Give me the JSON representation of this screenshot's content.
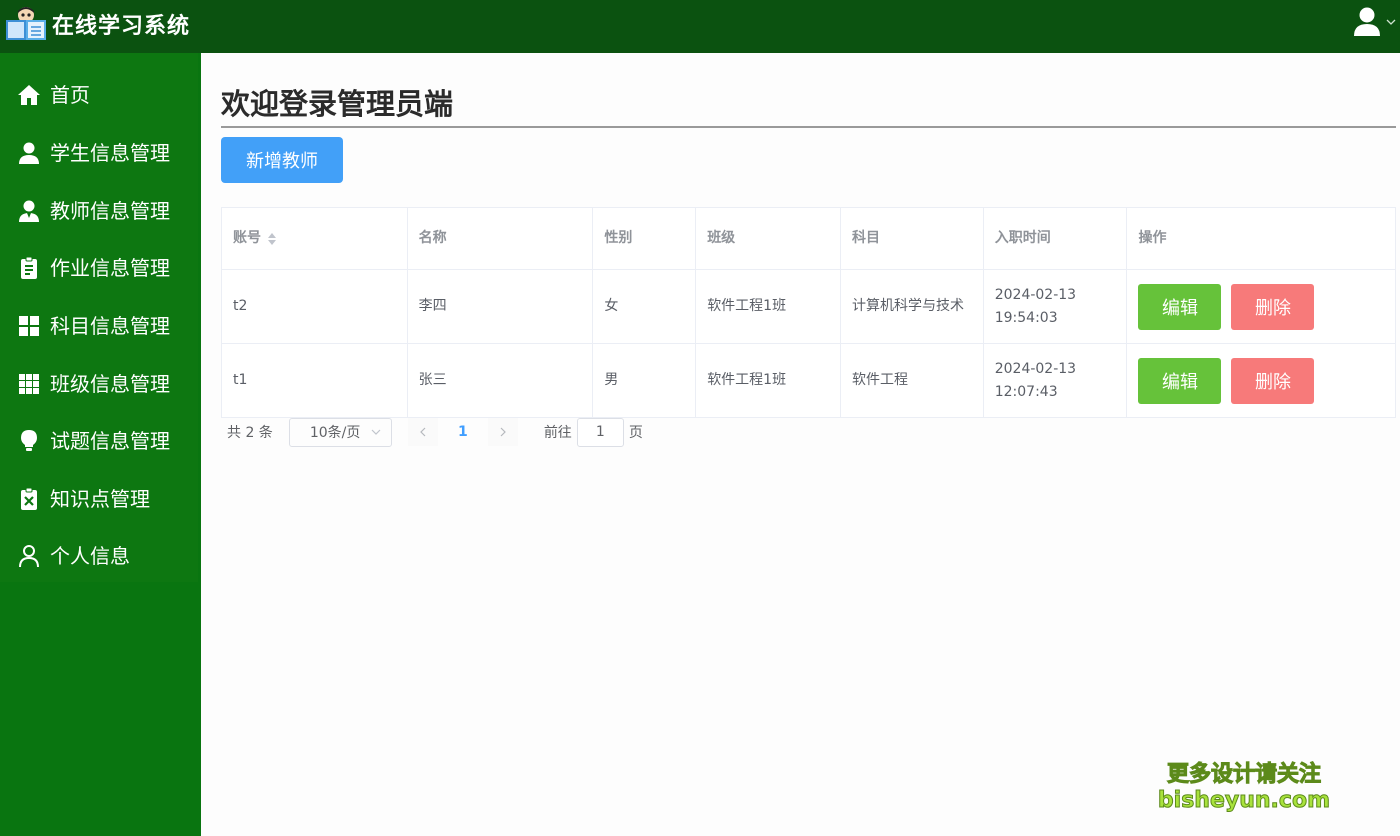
{
  "app": {
    "title": "在线学习系统"
  },
  "sidebar": {
    "items": [
      {
        "label": "首页",
        "icon": "home-icon"
      },
      {
        "label": "学生信息管理",
        "icon": "user-icon"
      },
      {
        "label": "教师信息管理",
        "icon": "teacher-icon"
      },
      {
        "label": "作业信息管理",
        "icon": "clipboard-icon"
      },
      {
        "label": "科目信息管理",
        "icon": "grid-icon"
      },
      {
        "label": "班级信息管理",
        "icon": "grid-nine-icon"
      },
      {
        "label": "试题信息管理",
        "icon": "lightbulb-icon"
      },
      {
        "label": "知识点管理",
        "icon": "clipboard-x-icon"
      },
      {
        "label": "个人信息",
        "icon": "person-outline-icon"
      }
    ]
  },
  "main": {
    "title": "欢迎登录管理员端",
    "add_button": "新增教师",
    "table": {
      "headers": [
        "账号",
        "名称",
        "性别",
        "班级",
        "科目",
        "入职时间",
        "操作"
      ],
      "rows": [
        {
          "account": "t2",
          "name": "李四",
          "gender": "女",
          "class": "软件工程1班",
          "subject": "计算机科学与技术",
          "joined": "2024-02-13 19:54:03"
        },
        {
          "account": "t1",
          "name": "张三",
          "gender": "男",
          "class": "软件工程1班",
          "subject": "软件工程",
          "joined": "2024-02-13 12:07:43"
        }
      ],
      "edit_label": "编辑",
      "delete_label": "删除"
    },
    "pagination": {
      "total": "共 2 条",
      "page_size": "10条/页",
      "current_page": "1",
      "goto_label": "前往",
      "goto_value": "1",
      "page_suffix": "页"
    }
  },
  "watermark": {
    "line1": "更多设计请关注",
    "line2": "bisheyun.com"
  },
  "colors": {
    "topbar": "#0b5210",
    "sidebar": "#0d7711",
    "primary": "#42a0f8",
    "edit": "#66c23a",
    "delete": "#f77a7a"
  }
}
